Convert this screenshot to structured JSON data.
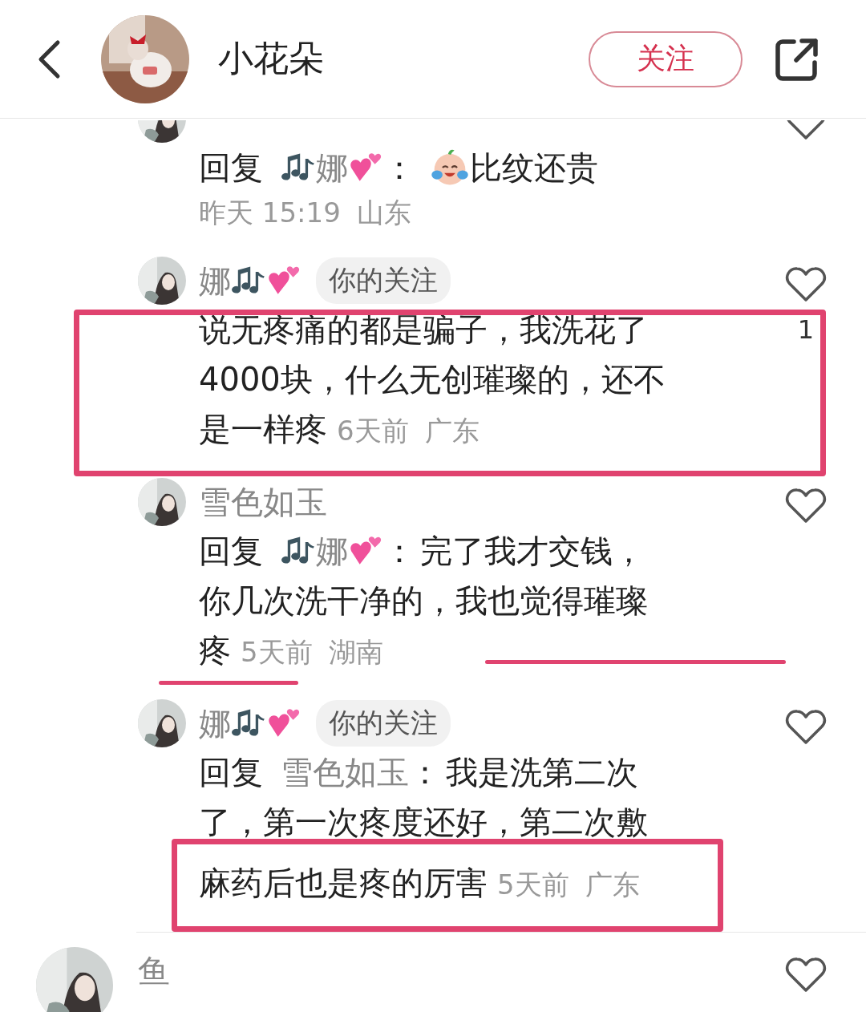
{
  "header": {
    "title": "小花朵",
    "follow_button": "关注"
  },
  "comments": [
    {
      "kind": "reply",
      "reply_label": "回复",
      "reply_to": "娜",
      "reply_icons": true,
      "reply_sep": "：",
      "laugh_emoji": true,
      "lines": [
        "比纹还贵"
      ],
      "meta_own_line": true,
      "time": "昨天 15:19",
      "location": "山东",
      "liked": false
    },
    {
      "kind": "comment",
      "name": "娜",
      "name_icons": true,
      "badge": "你的关注",
      "lines": [
        "说无疼痛的都是骗子，我洗花了",
        "4000块，什么无创璀璨的，还不",
        "是一样疼"
      ],
      "time": "6天前",
      "location": "广东",
      "likes": "1",
      "liked": false,
      "boxed": true
    },
    {
      "kind": "reply",
      "name": "雪色如玉",
      "name_icons": false,
      "reply_label": "回复",
      "reply_to": "娜",
      "reply_icons": true,
      "reply_sep": "：",
      "lines": [
        "完了我才交钱，",
        "你几次洗干净的，我也觉得璀璨",
        "疼"
      ],
      "time": "5天前",
      "location": "湖南",
      "liked": false,
      "underlined": true
    },
    {
      "kind": "reply",
      "name": "娜",
      "name_icons": true,
      "badge": "你的关注",
      "reply_label": "回复",
      "reply_to": "雪色如玉",
      "reply_icons": false,
      "reply_sep": "：",
      "lines": [
        "我是洗第二次",
        "了，第一次疼度还好，第二次敷",
        "麻药后也是疼的厉害"
      ],
      "time": "5天前",
      "location": "广东",
      "liked": false,
      "last_line_boxed": true
    },
    {
      "kind": "top",
      "name": "鱼",
      "liked": false
    }
  ]
}
